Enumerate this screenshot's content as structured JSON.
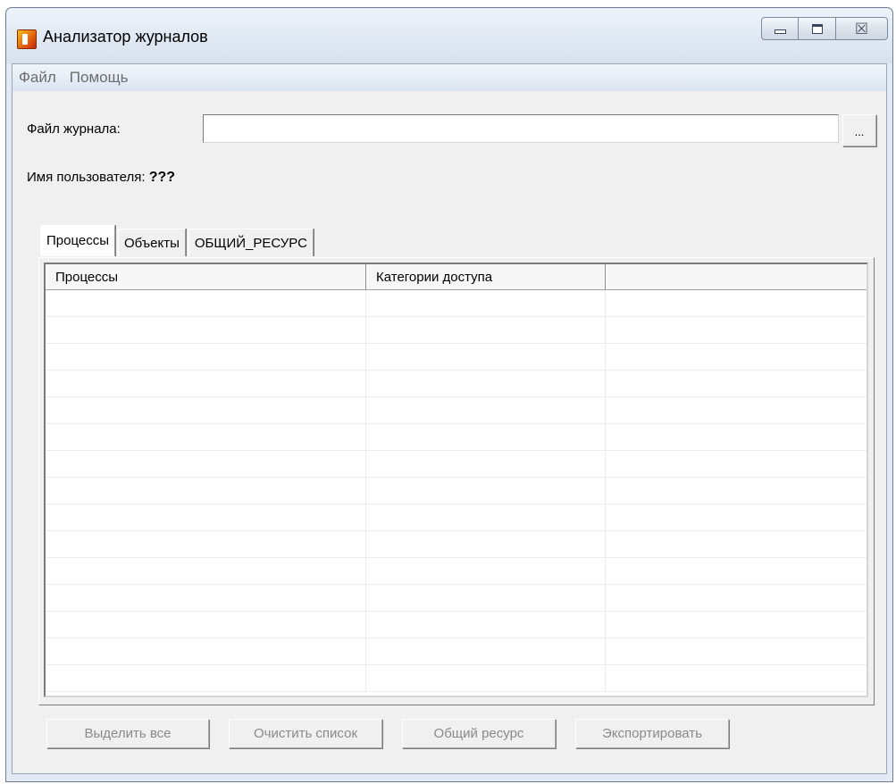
{
  "window": {
    "title": "Анализатор журналов",
    "close_glyph": "☒"
  },
  "menu": {
    "file": "Файл",
    "help": "Помощь"
  },
  "form": {
    "file_label": "Файл журнала:",
    "file_value": "",
    "browse_label": "...",
    "user_label": "Имя пользователя:",
    "user_value": "???"
  },
  "tabs": [
    {
      "label": "Процессы",
      "active": true
    },
    {
      "label": "Объекты",
      "active": false
    },
    {
      "label": "ОБЩИЙ_РЕСУРС",
      "active": false
    }
  ],
  "table": {
    "columns": [
      "Процессы",
      "Категории доступа",
      ""
    ],
    "rows": []
  },
  "buttons": {
    "select_all": "Выделить все",
    "clear_list": "Очистить список",
    "shared_resource": "Общий ресурс",
    "export": "Экспортировать"
  },
  "icons": {
    "app": "log-analyzer-app-icon",
    "minimize": "minimize-icon",
    "maximize": "maximize-icon",
    "close": "close-icon"
  }
}
